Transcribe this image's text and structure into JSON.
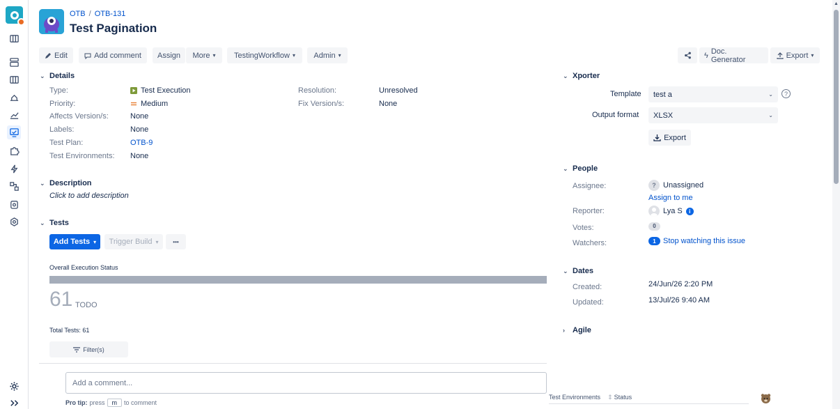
{
  "breadcrumb": {
    "project": "OTB",
    "separator": "/",
    "issue_key": "OTB-131"
  },
  "title": "Test Pagination",
  "toolbar": {
    "edit": "Edit",
    "add_comment": "Add comment",
    "assign": "Assign",
    "more": "More",
    "workflow": "TestingWorkflow",
    "admin": "Admin",
    "doc_generator": "Doc. Generator",
    "export": "Export"
  },
  "details": {
    "heading": "Details",
    "fields": [
      {
        "label": "Type:",
        "value": "Test Execution"
      },
      {
        "label": "Priority:",
        "value": "Medium"
      },
      {
        "label": "Affects Version/s:",
        "value": "None"
      },
      {
        "label": "Labels:",
        "value": "None"
      },
      {
        "label": "Test Plan:",
        "value": "OTB-9"
      },
      {
        "label": "Test Environments:",
        "value": "None"
      }
    ],
    "right_fields": [
      {
        "label": "Resolution:",
        "value": "Unresolved"
      },
      {
        "label": "Fix Version/s:",
        "value": "None"
      }
    ]
  },
  "description": {
    "heading": "Description",
    "placeholder": "Click to add description"
  },
  "tests": {
    "heading": "Tests",
    "add_tests": "Add Tests",
    "trigger_build": "Trigger Build",
    "more": "•••",
    "status_title": "Overall Execution Status",
    "todo_count": "61",
    "todo_label": "TODO",
    "progress": 1.0,
    "total_tests": "Total Tests: 61",
    "filters": "Filter(s)"
  },
  "comment": {
    "placeholder": "Add a comment...",
    "pro_tip_prefix": "Pro tip:",
    "press": "press",
    "key": "m",
    "to_comment": "to comment"
  },
  "bottom_table": {
    "col1": "Test Environments",
    "col2": "Status"
  },
  "xporter": {
    "heading": "Xporter",
    "template_label": "Template",
    "template_value": "test a",
    "output_label": "Output format",
    "output_value": "XLSX",
    "export": "Export"
  },
  "people": {
    "heading": "People",
    "assignee_label": "Assignee:",
    "assignee_value": "Unassigned",
    "assign_to_me": "Assign to me",
    "reporter_label": "Reporter:",
    "reporter_value": "Lya S",
    "votes_label": "Votes:",
    "votes_value": "0",
    "watchers_label": "Watchers:",
    "watchers_count": "1",
    "watchers_action": "Stop watching this issue"
  },
  "dates": {
    "heading": "Dates",
    "created_label": "Created:",
    "created_value": "24/Jun/26 2:20 PM",
    "updated_label": "Updated:",
    "updated_value": "13/Jul/26 9:40 AM"
  },
  "agile": {
    "heading": "Agile"
  },
  "colors": {
    "accent": "#0c66e4",
    "link": "#0052cc",
    "todo_bar": "#a5adba",
    "test_execution": "#7e9a3a",
    "priority_medium": "#e97f33"
  }
}
